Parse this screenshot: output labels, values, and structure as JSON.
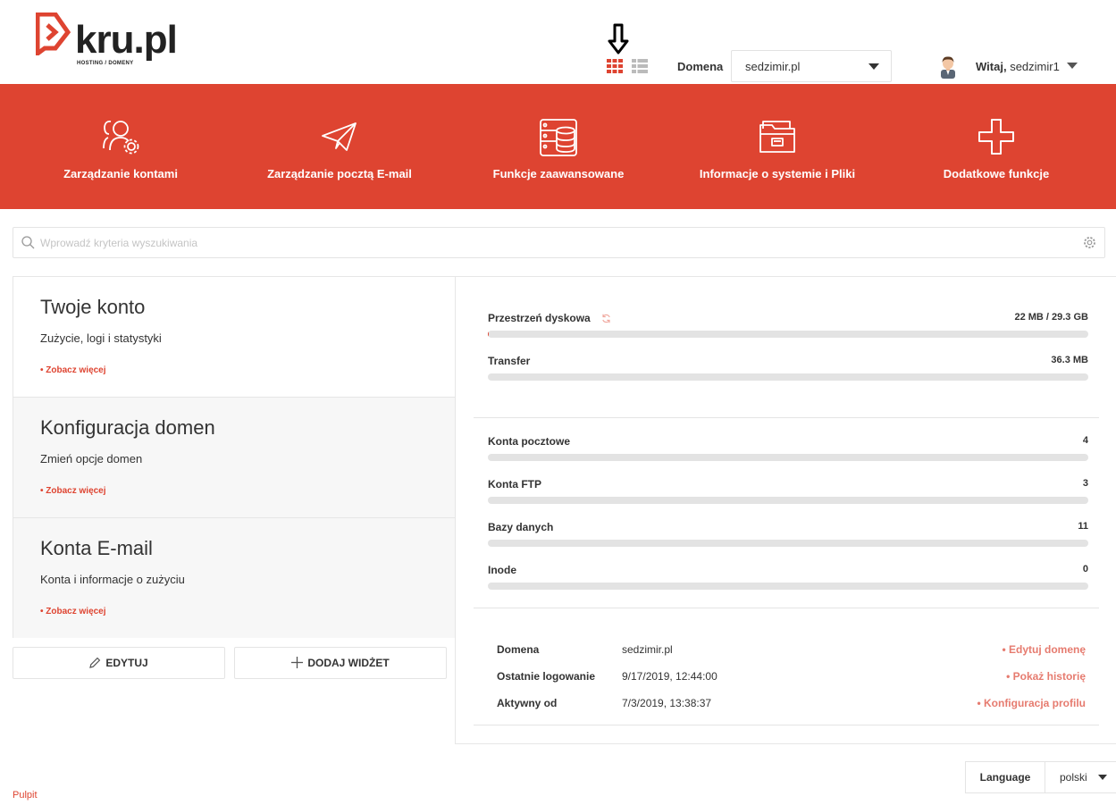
{
  "header": {
    "logo_text": "kru.pl",
    "logo_subtitle": "HOSTING / DOMENY",
    "domain_label": "Domena",
    "domain_value": "sedzimir.pl",
    "welcome_prefix": "Witaj,",
    "username": "sedzimir1",
    "view_icons": [
      "grid-view-icon",
      "list-view-icon"
    ]
  },
  "nav": {
    "items": [
      {
        "label": "Zarządzanie kontami",
        "icon": "users-gear-icon"
      },
      {
        "label": "Zarządzanie pocztą E-mail",
        "icon": "paper-plane-icon"
      },
      {
        "label": "Funkcje zaawansowane",
        "icon": "server-database-icon"
      },
      {
        "label": "Informacje o systemie i Pliki",
        "icon": "folder-icon"
      },
      {
        "label": "Dodatkowe funkcje",
        "icon": "plus-icon"
      }
    ]
  },
  "search": {
    "placeholder": "Wprowadź kryteria wyszukiwania"
  },
  "widgets": [
    {
      "title": "Twoje konto",
      "desc": "Zużycie, logi i statystyki",
      "more": "• Zobacz więcej"
    },
    {
      "title": "Konfiguracja domen",
      "desc": "Zmień opcje domen",
      "more": "• Zobacz więcej"
    },
    {
      "title": "Konta E-mail",
      "desc": "Konta i informacje o zużyciu",
      "more": "• Zobacz więcej"
    }
  ],
  "buttons": {
    "edit": "EDYTUJ",
    "add_widget": "DODAJ WIDŻET"
  },
  "stats": {
    "usage": [
      {
        "name": "Przestrzeń dyskowa",
        "value": "22 MB / 29.3 GB",
        "fill_pct": 0.1
      },
      {
        "name": "Transfer",
        "value": "36.3 MB",
        "fill_pct": 0
      }
    ],
    "counts": [
      {
        "name": "Konta pocztowe",
        "value": "4",
        "fill_pct": 0
      },
      {
        "name": "Konta FTP",
        "value": "3",
        "fill_pct": 0
      },
      {
        "name": "Bazy danych",
        "value": "11",
        "fill_pct": 0
      },
      {
        "name": "Inode",
        "value": "0",
        "fill_pct": 0
      }
    ]
  },
  "info": [
    {
      "label": "Domena",
      "value": "sedzimir.pl",
      "link": "• Edytuj domenę"
    },
    {
      "label": "Ostatnie logowanie",
      "value": "9/17/2019, 12:44:00",
      "link": "• Pokaż historię"
    },
    {
      "label": "Aktywny od",
      "value": "7/3/2019, 13:38:37",
      "link": "• Konfiguracja profilu"
    }
  ],
  "footer": {
    "breadcrumb": "Pulpit",
    "language_label": "Language",
    "language_value": "polski"
  },
  "colors": {
    "accent": "#de4431",
    "link_light": "#e67b6f",
    "bar_track": "#e3e3e3"
  }
}
